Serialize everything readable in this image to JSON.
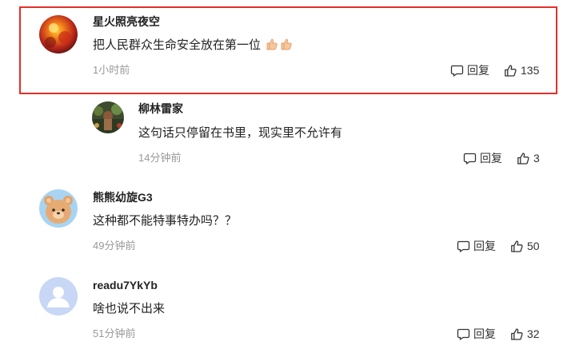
{
  "comments": [
    {
      "user": "星火照亮夜空",
      "text": "把人民群众生命安全放在第一位",
      "time": "1小时前",
      "reply_label": "回复",
      "likes": "135",
      "avatar_icon": "fire-avatar",
      "highlighted": true
    },
    {
      "user": "柳林雷家",
      "text": "这句话只停留在书里，现实里不允许有",
      "time": "14分钟前",
      "reply_label": "回复",
      "likes": "3",
      "avatar_icon": "garden-photo-avatar"
    },
    {
      "user": "熊熊幼旋G3",
      "text": "这种都不能特事特办吗？？",
      "time": "49分钟前",
      "reply_label": "回复",
      "likes": "50",
      "avatar_icon": "bear-avatar"
    },
    {
      "user": "readu7YkYb",
      "text": "啥也说不出来",
      "time": "51分钟前",
      "reply_label": "回复",
      "likes": "32",
      "avatar_icon": "default-user-avatar"
    }
  ],
  "colors": {
    "highlight": "#e0302a",
    "time_text": "#999999",
    "default_avatar_bg": "#c7d7f5"
  }
}
